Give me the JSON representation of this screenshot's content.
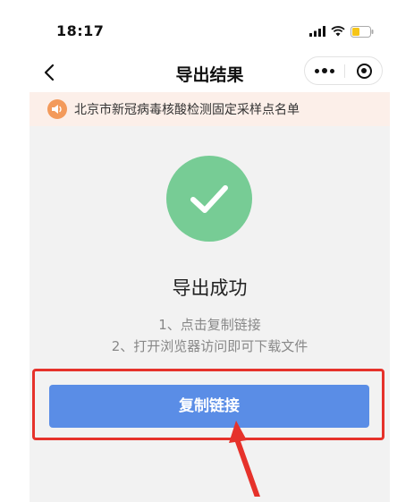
{
  "status_bar": {
    "time": "18:17",
    "icons": [
      "signal-icon",
      "wifi-icon",
      "battery-icon"
    ],
    "battery_color": "#f5c518"
  },
  "nav": {
    "title": "导出结果",
    "back_icon": "chevron-left-icon",
    "more_icon": "more-dots-icon",
    "close_icon": "target-close-icon"
  },
  "notice": {
    "icon": "speaker-icon",
    "text": "北京市新冠病毒核酸检测固定采样点名单",
    "background": "#fcefe9",
    "icon_color": "#f39a5b"
  },
  "result": {
    "icon": "checkmark-icon",
    "icon_color": "#77cc95",
    "title": "导出成功",
    "steps": [
      "1、点击复制链接",
      "2、打开浏览器访问即可下载文件"
    ]
  },
  "actions": {
    "copy_label": "复制链接",
    "button_color": "#5a8de6"
  },
  "annotation": {
    "highlight_color": "#e6322b"
  }
}
